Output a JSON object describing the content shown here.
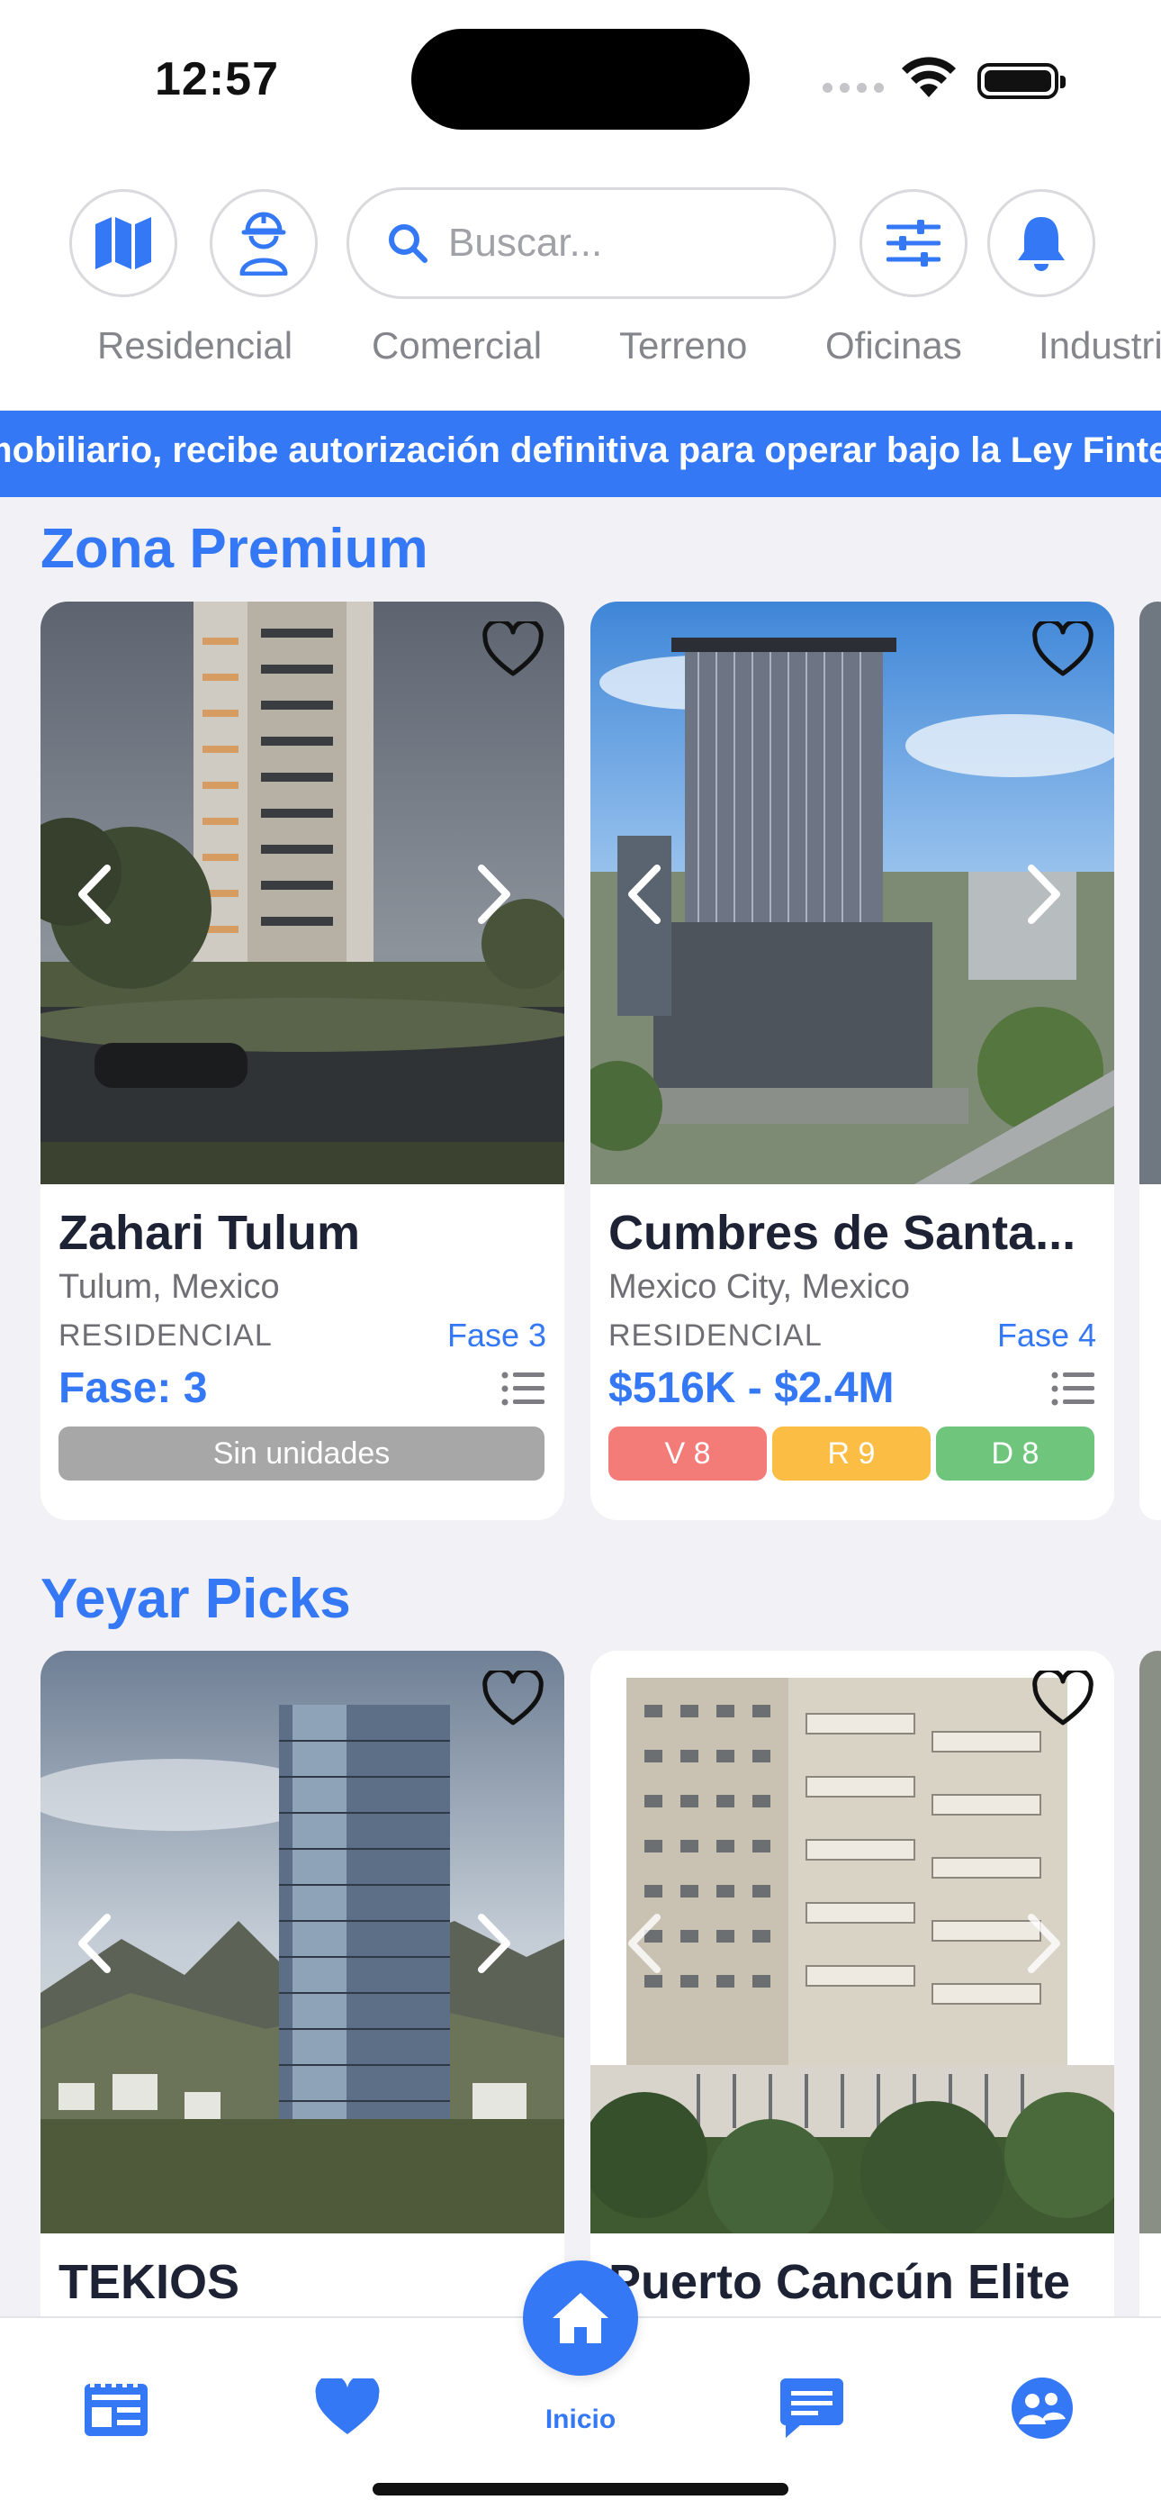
{
  "status_bar": {
    "time": "12:57"
  },
  "header": {
    "search_placeholder": "Buscar...",
    "buttons": [
      "map-icon",
      "worker-icon",
      "filter-icon",
      "bell-icon"
    ]
  },
  "categories": [
    "Residencial",
    "Comercial",
    "Terreno",
    "Oficinas",
    "Industrial"
  ],
  "ticker_text": "mobiliario, recibe autorización definitiva para operar bajo la Ley Fintech",
  "sections": [
    {
      "title": "Zona Premium",
      "cards": [
        {
          "name": "Zahari Tulum",
          "location": "Tulum, Mexico",
          "type": "RESIDENCIAL",
          "phase": "Fase 3",
          "price": "Fase: 3",
          "status": "Sin unidades"
        },
        {
          "name": "Cumbres de Santa...",
          "location": "Mexico City, Mexico",
          "type": "RESIDENCIAL",
          "phase": "Fase 4",
          "price": "$516K - $2.4M",
          "pills": [
            "V 8",
            "R 9",
            "D 8"
          ]
        }
      ]
    },
    {
      "title": "Yeyar Picks",
      "cards": [
        {
          "name": "TEKIOS"
        },
        {
          "name": "Puerto Cancún Elite"
        }
      ]
    }
  ],
  "tabbar": {
    "home_label": "Inicio",
    "tabs": [
      "listings-icon",
      "heart-icon",
      "home-icon",
      "chat-icon",
      "community-icon"
    ]
  },
  "colors": {
    "accent": "#3478f6",
    "pill_v": "#f47c78",
    "pill_r": "#fbbd43",
    "pill_d": "#6fc57c",
    "disabled": "#a7a7a7"
  }
}
